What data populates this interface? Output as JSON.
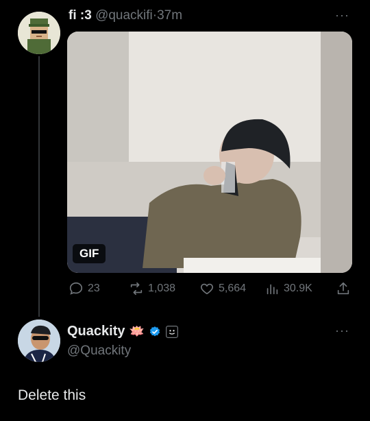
{
  "post": {
    "display_name": "fi :3",
    "handle": "@quackifi",
    "separator": "·",
    "time": "37m",
    "more_label": "···",
    "media_badge": "GIF",
    "stats": {
      "replies": "23",
      "reposts": "1,038",
      "likes": "5,664",
      "views": "30.9K"
    }
  },
  "reply": {
    "display_name": "Quackity",
    "emoji": "🪷",
    "handle": "@Quackity",
    "more_label": "···",
    "text": "Delete this"
  },
  "colors": {
    "background": "#000000",
    "text_primary": "#e7e9ea",
    "text_secondary": "#71767b",
    "verified": "#1d9bf0"
  }
}
